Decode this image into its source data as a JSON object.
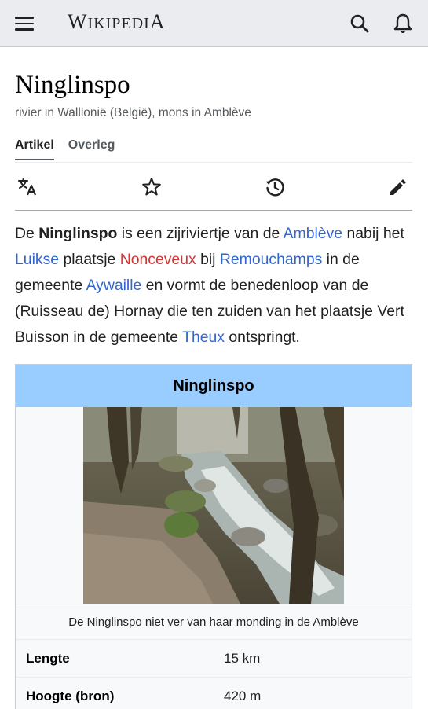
{
  "header": {
    "logo_initial": "W",
    "logo_rest": "IKIPEDI",
    "logo_last": "A"
  },
  "page": {
    "title": "Ninglinspo",
    "subtitle": "rivier in Walllonië (België), mons in Amblève"
  },
  "tabs": [
    {
      "label": "Artikel",
      "active": true
    },
    {
      "label": "Overleg",
      "active": false
    }
  ],
  "lead": {
    "t1": "De ",
    "bold": "Ninglinspo",
    "t2": " is een zijriviertje van de ",
    "link_ambleve": "Amblève",
    "t3": " nabij het ",
    "link_luikse": "Luikse",
    "t4": " plaatsje ",
    "link_nonceveux": "Nonceveux",
    "t5": " bij ",
    "link_remouchamps": "Remouchamps",
    "t6": " in de gemeente ",
    "link_aywaille": "Aywaille",
    "t7": " en vormt de benedenloop van de (Ruisseau de) Hornay die ten zuiden van het plaatsje Vert Buisson in de gemeente ",
    "link_theux": "Theux",
    "t8": " ontspringt."
  },
  "infobox": {
    "title": "Ninglinspo",
    "caption": "De Ninglinspo niet ver van haar monding in de Amblève",
    "rows": [
      {
        "label": "Lengte",
        "value": "15 km"
      },
      {
        "label": "Hoogte (bron)",
        "value": "420 m"
      }
    ]
  },
  "colors": {
    "link": "#3366cc",
    "redlink": "#d73333",
    "infobox_header": "#99ccff"
  }
}
